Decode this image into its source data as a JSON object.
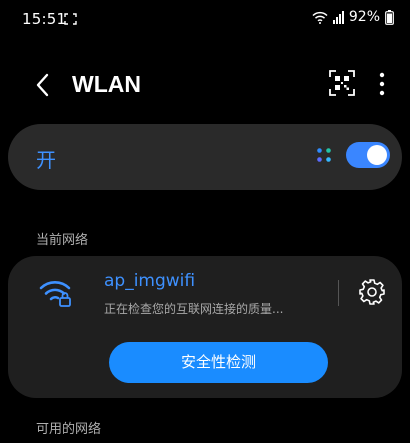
{
  "status_bar": {
    "time": "15:51",
    "battery": "92%",
    "icons": [
      "focus-icon",
      "wifi-signal-icon",
      "cellular-signal-icon",
      "battery-icon"
    ]
  },
  "header": {
    "title": "WLAN",
    "icons": [
      "back-arrow-icon",
      "qr-code-icon",
      "more-options-icon"
    ]
  },
  "wlan_toggle": {
    "label": "开",
    "on": true,
    "icons": [
      "multicolor-dots-icon"
    ]
  },
  "current_network": {
    "section_label": "当前网络",
    "name": "ap_imgwifi",
    "status": "正在检查您的互联网连接的质量...",
    "button_label": "安全性检测",
    "icons": [
      "wifi-locked-icon",
      "gear-icon"
    ]
  },
  "available_networks": {
    "section_label": "可用的网络"
  },
  "colors": {
    "accent": "#3e91ff",
    "button": "#1a8cff",
    "card": "#2a2a2a",
    "background": "#000000"
  }
}
